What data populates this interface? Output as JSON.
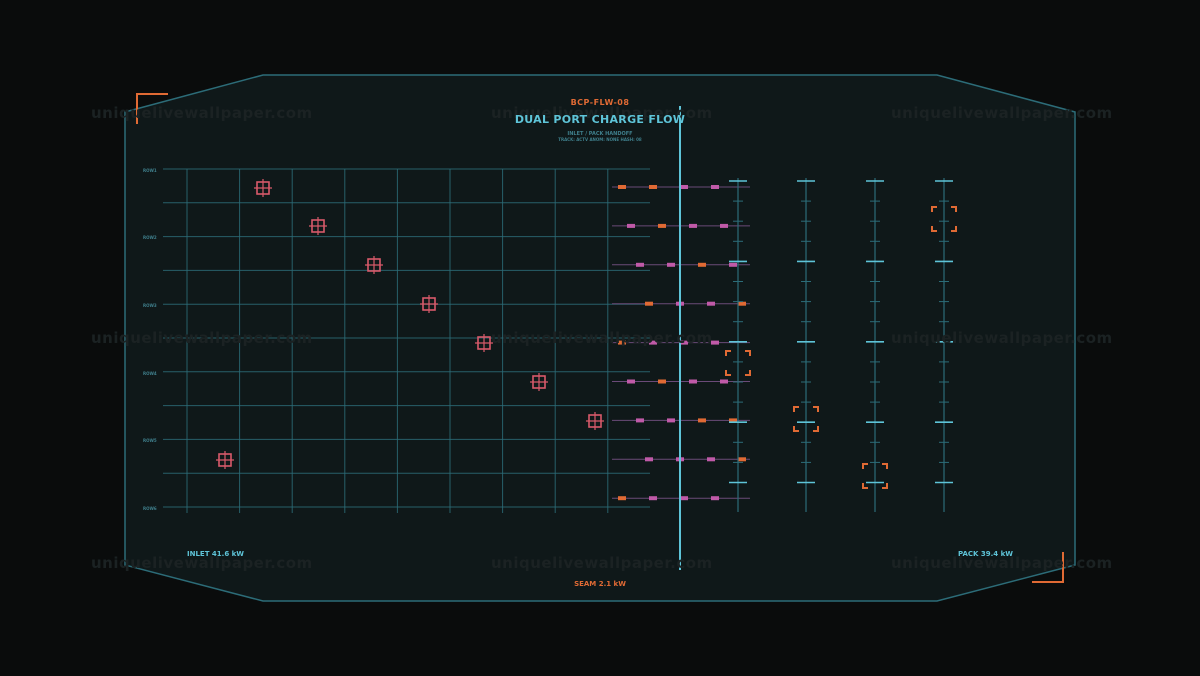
{
  "panel": {
    "code": "BCP-FLW-08",
    "title": "DUAL PORT CHARGE FLOW",
    "subtitle_line1": "INLET / PACK HANDOFF",
    "subtitle_line2": "TRACK: ACTV  ANOM: NONE  HASH: 08"
  },
  "readouts": {
    "inlet": "INLET 41.6 kW",
    "pack": "PACK 39.4 kW",
    "seam": "SEAM 2.1 kW"
  },
  "row_labels": [
    "ROW1",
    "ROW2",
    "ROW3",
    "ROW4",
    "ROW5",
    "ROW6"
  ],
  "watermark": "uniquelivewallpaper.com",
  "colors": {
    "background": "#0a0c0c",
    "panel": "#0f1819",
    "grid": "#2c6c78",
    "cyan_accent": "#5ec4d8",
    "orange_accent": "#e06a34",
    "magenta": "#c05aa8",
    "marker": "#d85a6a"
  },
  "icons": [
    "crosshair-marker-icon",
    "bracket-reticle-icon",
    "corner-bracket-icon"
  ]
}
